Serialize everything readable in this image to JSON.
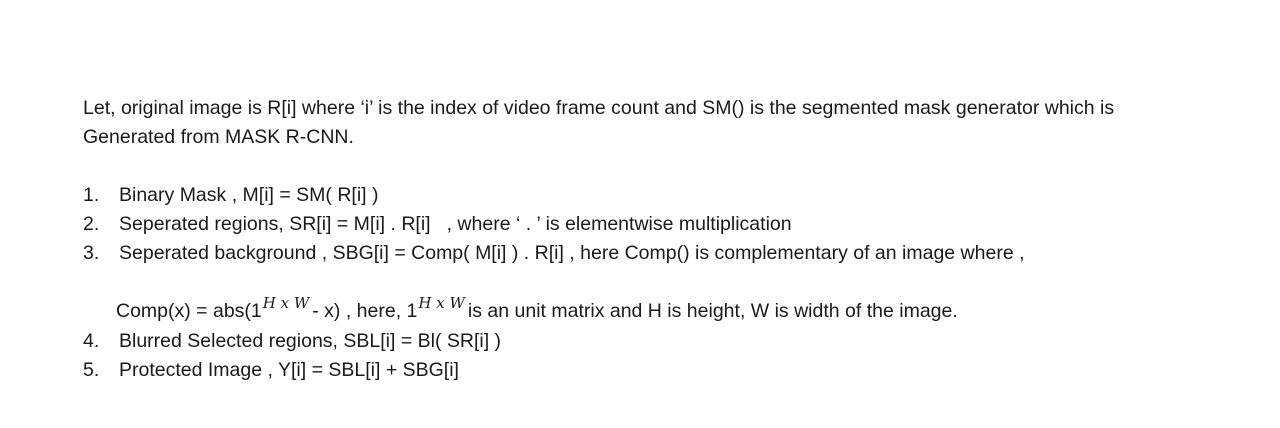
{
  "intro": {
    "line1": "Let, original image is R[i] where ‘i’ is the index of video frame count and SM() is the segmented mask generator which is",
    "line2": "Generated from MASK R-CNN."
  },
  "steps": [
    {
      "num": "1.",
      "text": "Binary Mask , M[i] = SM( R[i] )"
    },
    {
      "num": "2.",
      "text_a": "Seperated regions, SR[i] = M[i] . R[i]",
      "text_b": ", where ‘ . ’ is elementwise multiplication"
    },
    {
      "num": "3.",
      "text": "Seperated background , SBG[i] = Comp( M[i] ) . R[i] , here Comp() is complementary of an image where ,"
    },
    {
      "num": "4.",
      "text": "Blurred Selected regions, SBL[i] = Bl( SR[i] )"
    },
    {
      "num": "5.",
      "text": "Protected Image , Y[i] = SBL[i] + SBG[i]"
    }
  ],
  "comp_formula": {
    "part1": "Comp(x) = abs(1",
    "sup1": "H x W",
    "part2": "- x) , here, 1",
    "sup2": "H x W",
    "part3": "is an unit matrix and  H is height, W is width of the image."
  }
}
